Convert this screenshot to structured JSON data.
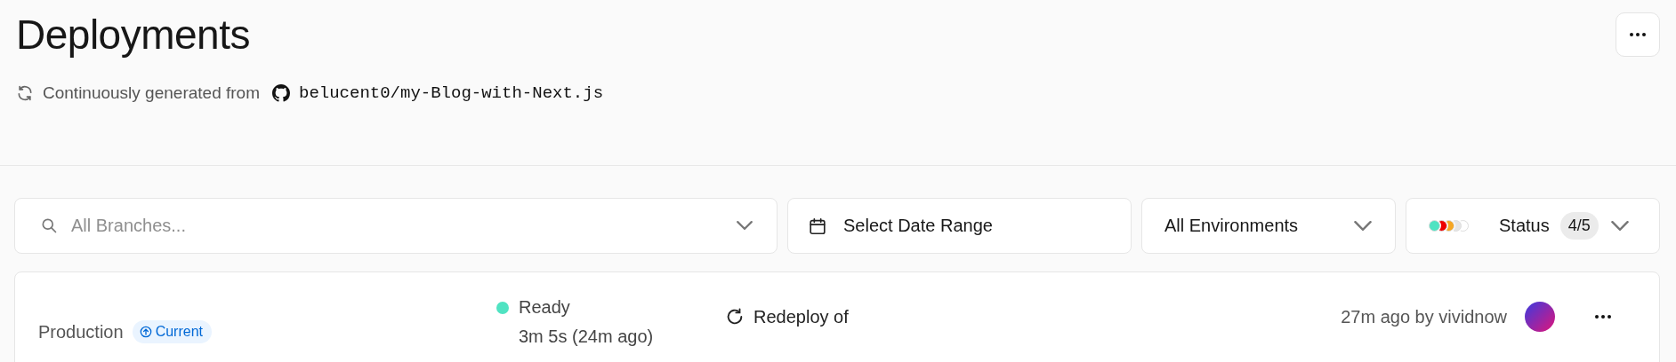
{
  "header": {
    "title": "Deployments",
    "source_text": "Continuously generated from",
    "repository": "belucent0/my-Blog-with-Next.js"
  },
  "filters": {
    "branch": {
      "placeholder": "All Branches..."
    },
    "date": {
      "label": "Select Date Range"
    },
    "environment": {
      "label": "All Environments"
    },
    "status": {
      "label": "Status",
      "count": "4/5",
      "dots": [
        {
          "color": "#50e3c2"
        },
        {
          "color": "#ee0000"
        },
        {
          "color": "#f5a623"
        },
        {
          "color": "#e5e5e5"
        },
        {
          "color": "#ffffff"
        }
      ]
    }
  },
  "deployments": [
    {
      "environment": "Production",
      "badge": "Current",
      "state": "Ready",
      "color": "#50e3c2",
      "duration": "3m 5s (24m ago)",
      "action": "Redeploy of",
      "created": "27m ago by vividnow"
    }
  ]
}
